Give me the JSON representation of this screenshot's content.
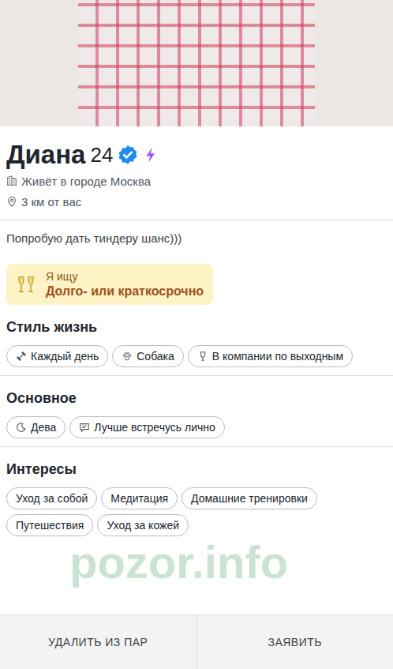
{
  "profile": {
    "name": "Диана",
    "age": "24",
    "verified": true,
    "city": "Живёт в городе Москва",
    "distance": "3 км от вас",
    "bio": "Попробую дать тиндеру шанс)))"
  },
  "looking_for": {
    "label": "Я ищу",
    "value": "Долго- или краткосрочно"
  },
  "sections": [
    {
      "title": "Стиль жизнь",
      "chips": [
        "Каждый день",
        "Собака",
        "В компании по выходным"
      ]
    },
    {
      "title": "Основное",
      "chips": [
        "Дева",
        "Лучше встречусь лично"
      ]
    },
    {
      "title": "Интересы",
      "chips": [
        "Уход за собой",
        "Медитация",
        "Домашние тренировки",
        "Путешествия",
        "Уход за кожей"
      ]
    }
  ],
  "buttons": [
    "УДАЛИТЬ ИЗ ПАР",
    "ЗАЯВИТЬ"
  ],
  "watermark": "pozor.info"
}
